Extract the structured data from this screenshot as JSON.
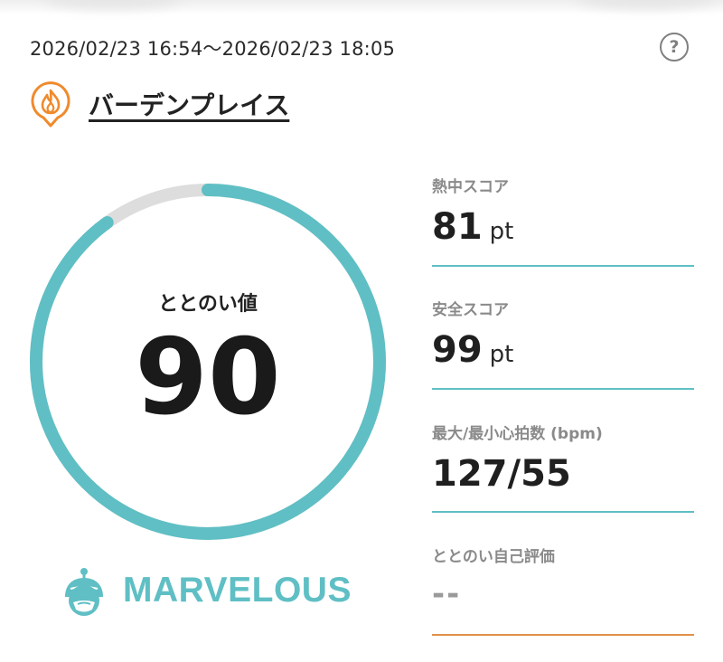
{
  "session": {
    "date_range": "2026/02/23 16:54～2026/02/23 18:05",
    "help_label": "?"
  },
  "facility": {
    "name": "バーデンプレイス",
    "icon": "sauna-fire-pin-icon",
    "icon_color": "#f08a2c"
  },
  "totonoi": {
    "label": "ととのい値",
    "value": "90",
    "progress_percent": 90,
    "ring_color": "#5fbfc4",
    "ring_track_color": "#dddddd",
    "rank": "MARVELOUS",
    "rank_icon": "sauna-hat-face-icon"
  },
  "metrics": [
    {
      "label": "熱中スコア",
      "value": "81",
      "unit": "pt",
      "line_color": "#5fbfc4"
    },
    {
      "label": "安全スコア",
      "value": "99",
      "unit": "pt",
      "line_color": "#5fbfc4"
    },
    {
      "label": "最大/最小心拍数 (bpm)",
      "value": "127/55",
      "unit": "",
      "line_color": "#5fbfc4"
    },
    {
      "label": "ととのい自己評価",
      "value": "--",
      "unit": "",
      "line_color": "#e0914a"
    }
  ]
}
